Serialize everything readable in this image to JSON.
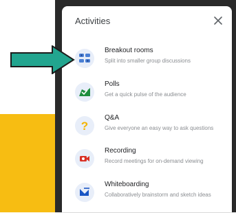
{
  "panel": {
    "title": "Activities",
    "close_label": "×"
  },
  "items": [
    {
      "label": "Breakout rooms",
      "desc": "Split into smaller group discussions",
      "icon": "breakout-rooms-icon"
    },
    {
      "label": "Polls",
      "desc": "Get a quick pulse of the audience",
      "icon": "polls-icon"
    },
    {
      "label": "Q&A",
      "desc": "Give everyone an easy way to ask questions",
      "icon": "qa-icon"
    },
    {
      "label": "Recording",
      "desc": "Record meetings for on-demand viewing",
      "icon": "recording-icon"
    },
    {
      "label": "Whiteboarding",
      "desc": "Collaboratively brainstorm and sketch ideas",
      "icon": "whiteboard-icon"
    }
  ],
  "colors": {
    "accent_teal": "#22a58f",
    "background_yellow": "#f7bd12",
    "panel_dark": "#2a2a2a"
  }
}
